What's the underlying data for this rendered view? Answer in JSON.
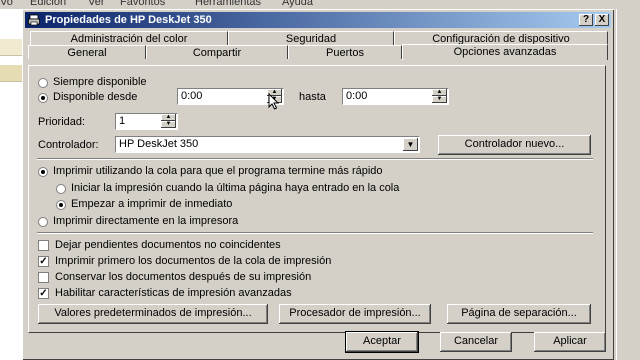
{
  "background": {
    "menu_items": [
      "Vo",
      "Edición",
      "Ver",
      "Favoritos",
      "Herramientas",
      "Ayuda"
    ]
  },
  "dialog": {
    "title": "Propiedades de HP DeskJet 350",
    "help_button": "?",
    "close_button": "X"
  },
  "tabs_back": [
    "Administración del color",
    "Seguridad",
    "Configuración de dispositivo"
  ],
  "tabs_front": [
    "General",
    "Compartir",
    "Puertos",
    "Opciones avanzadas"
  ],
  "availability": {
    "always_label": "Siempre disponible",
    "from_label": "Disponible desde",
    "until_label": "hasta",
    "from_value": "0:00",
    "until_value": "0:00",
    "selected": "from"
  },
  "priority": {
    "label": "Prioridad:",
    "value": "1"
  },
  "driver": {
    "label": "Controlador:",
    "value": "HP DeskJet 350",
    "new_button": "Controlador nuevo..."
  },
  "spool": {
    "spool_label": "Imprimir utilizando la cola para que el programa termine más rápido",
    "after_last_page": "Iniciar la impresión cuando la última página haya entrado en la cola",
    "immediately": "Empezar a imprimir de inmediato",
    "direct": "Imprimir directamente en la impresora"
  },
  "options": [
    {
      "label": "Dejar pendientes documentos no coincidentes",
      "checked": false
    },
    {
      "label": "Imprimir primero los documentos de la cola de impresión",
      "checked": true
    },
    {
      "label": "Conservar los documentos después de su impresión",
      "checked": false
    },
    {
      "label": "Habilitar características de impresión avanzadas",
      "checked": true
    }
  ],
  "bottom_buttons": {
    "defaults": "Valores predeterminados de impresión...",
    "processor": "Procesador de impresión...",
    "separator": "Página de separación..."
  },
  "dialog_buttons": {
    "ok": "Aceptar",
    "cancel": "Cancelar",
    "apply": "Aplicar"
  },
  "colors": {
    "title_gradient_start": "#0a246a",
    "title_gradient_end": "#a6caf0",
    "face": "#d4d0c8"
  }
}
